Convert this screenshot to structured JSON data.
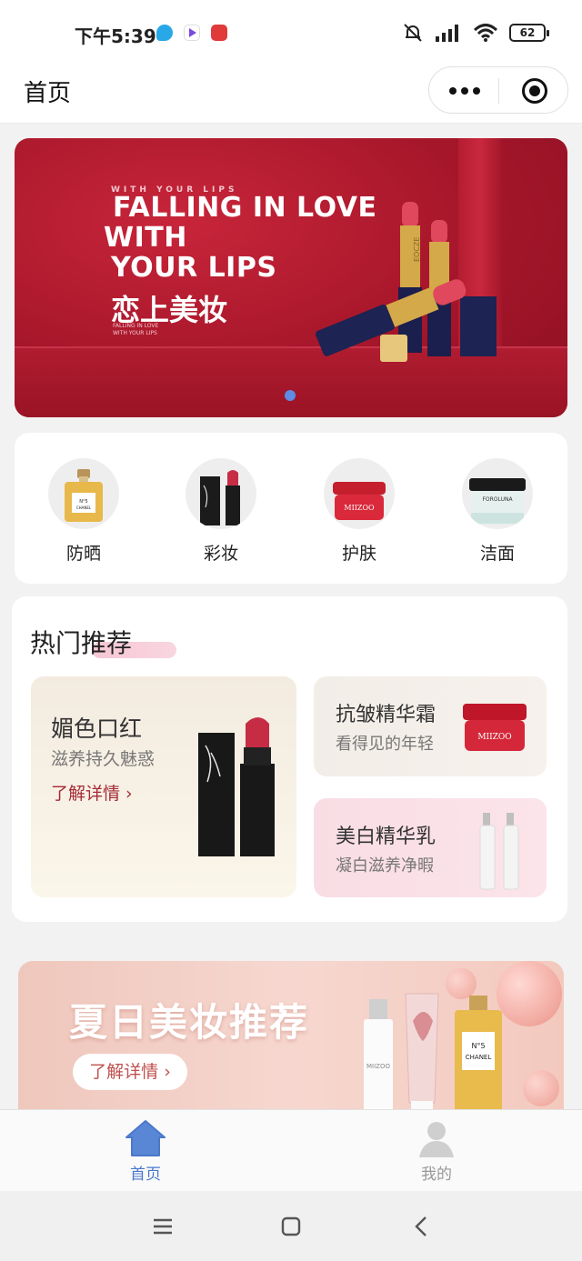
{
  "status_bar": {
    "time": "下午5:39",
    "battery": "62"
  },
  "nav": {
    "title": "首页"
  },
  "banner": {
    "small_top": "WITH YOUR LIPS",
    "headline_lines": [
      "FALLING IN LOVE",
      "WITH",
      "YOUR LIPS"
    ],
    "headline_cn": "恋上美妆",
    "tiny_text": "FALLING IN LOVE WITH YOUR LIPS",
    "product_brand": "EOCZE",
    "active_indicator": 1,
    "indicator_count": 1
  },
  "categories": [
    {
      "label": "防晒",
      "icon": "perfume-bottle-icon"
    },
    {
      "label": "彩妆",
      "icon": "lipstick-icon"
    },
    {
      "label": "护肤",
      "icon": "cream-jar-icon"
    },
    {
      "label": "洁面",
      "icon": "cleanser-jar-icon"
    }
  ],
  "hot": {
    "title": "热门推荐",
    "big_tile": {
      "title": "媚色口红",
      "subtitle": "滋养持久魅惑",
      "link": "了解详情 ›"
    },
    "tile_top": {
      "title": "抗皱精华霜",
      "subtitle": "看得见的年轻",
      "brand": "MIIZOO"
    },
    "tile_bottom": {
      "title": "美白精华乳",
      "subtitle": "凝白滋养净暇"
    }
  },
  "summer": {
    "title": "夏日美妆推荐",
    "button": "了解详情 ›",
    "brand_left": "MIIZOO",
    "brand_right": "CHANEL",
    "perfume_no": "N°5"
  },
  "tabbar": {
    "items": [
      {
        "label": "首页",
        "active": true
      },
      {
        "label": "我的",
        "active": false
      }
    ],
    "active_color": "#4a78c9",
    "inactive_color": "#999999"
  }
}
